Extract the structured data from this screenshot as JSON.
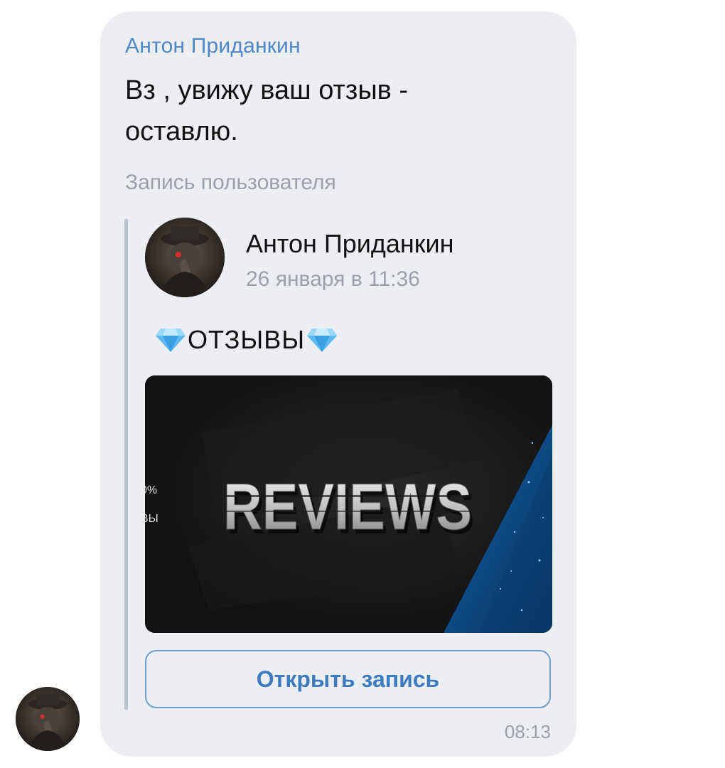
{
  "message": {
    "sender": "Антон Приданкин",
    "text": "Вз , увижу ваш отзыв - оставлю.",
    "time": "08:13"
  },
  "repost": {
    "label": "Запись пользователя",
    "author": "Антон Приданкин",
    "date": "26 января в 11:36",
    "post_title": "ОТЗЫВЫ",
    "image": {
      "main_text": "REVIEWS",
      "side_text_top": "0%",
      "side_text_bottom": "ВЫ"
    },
    "open_button": "Открыть запись"
  },
  "icons": {
    "title_prefix": "diamond-icon",
    "title_suffix": "diamond-icon"
  },
  "colors": {
    "accent": "#4f88c6",
    "bubble": "#eceef2",
    "button_text": "#3f7bbf"
  }
}
